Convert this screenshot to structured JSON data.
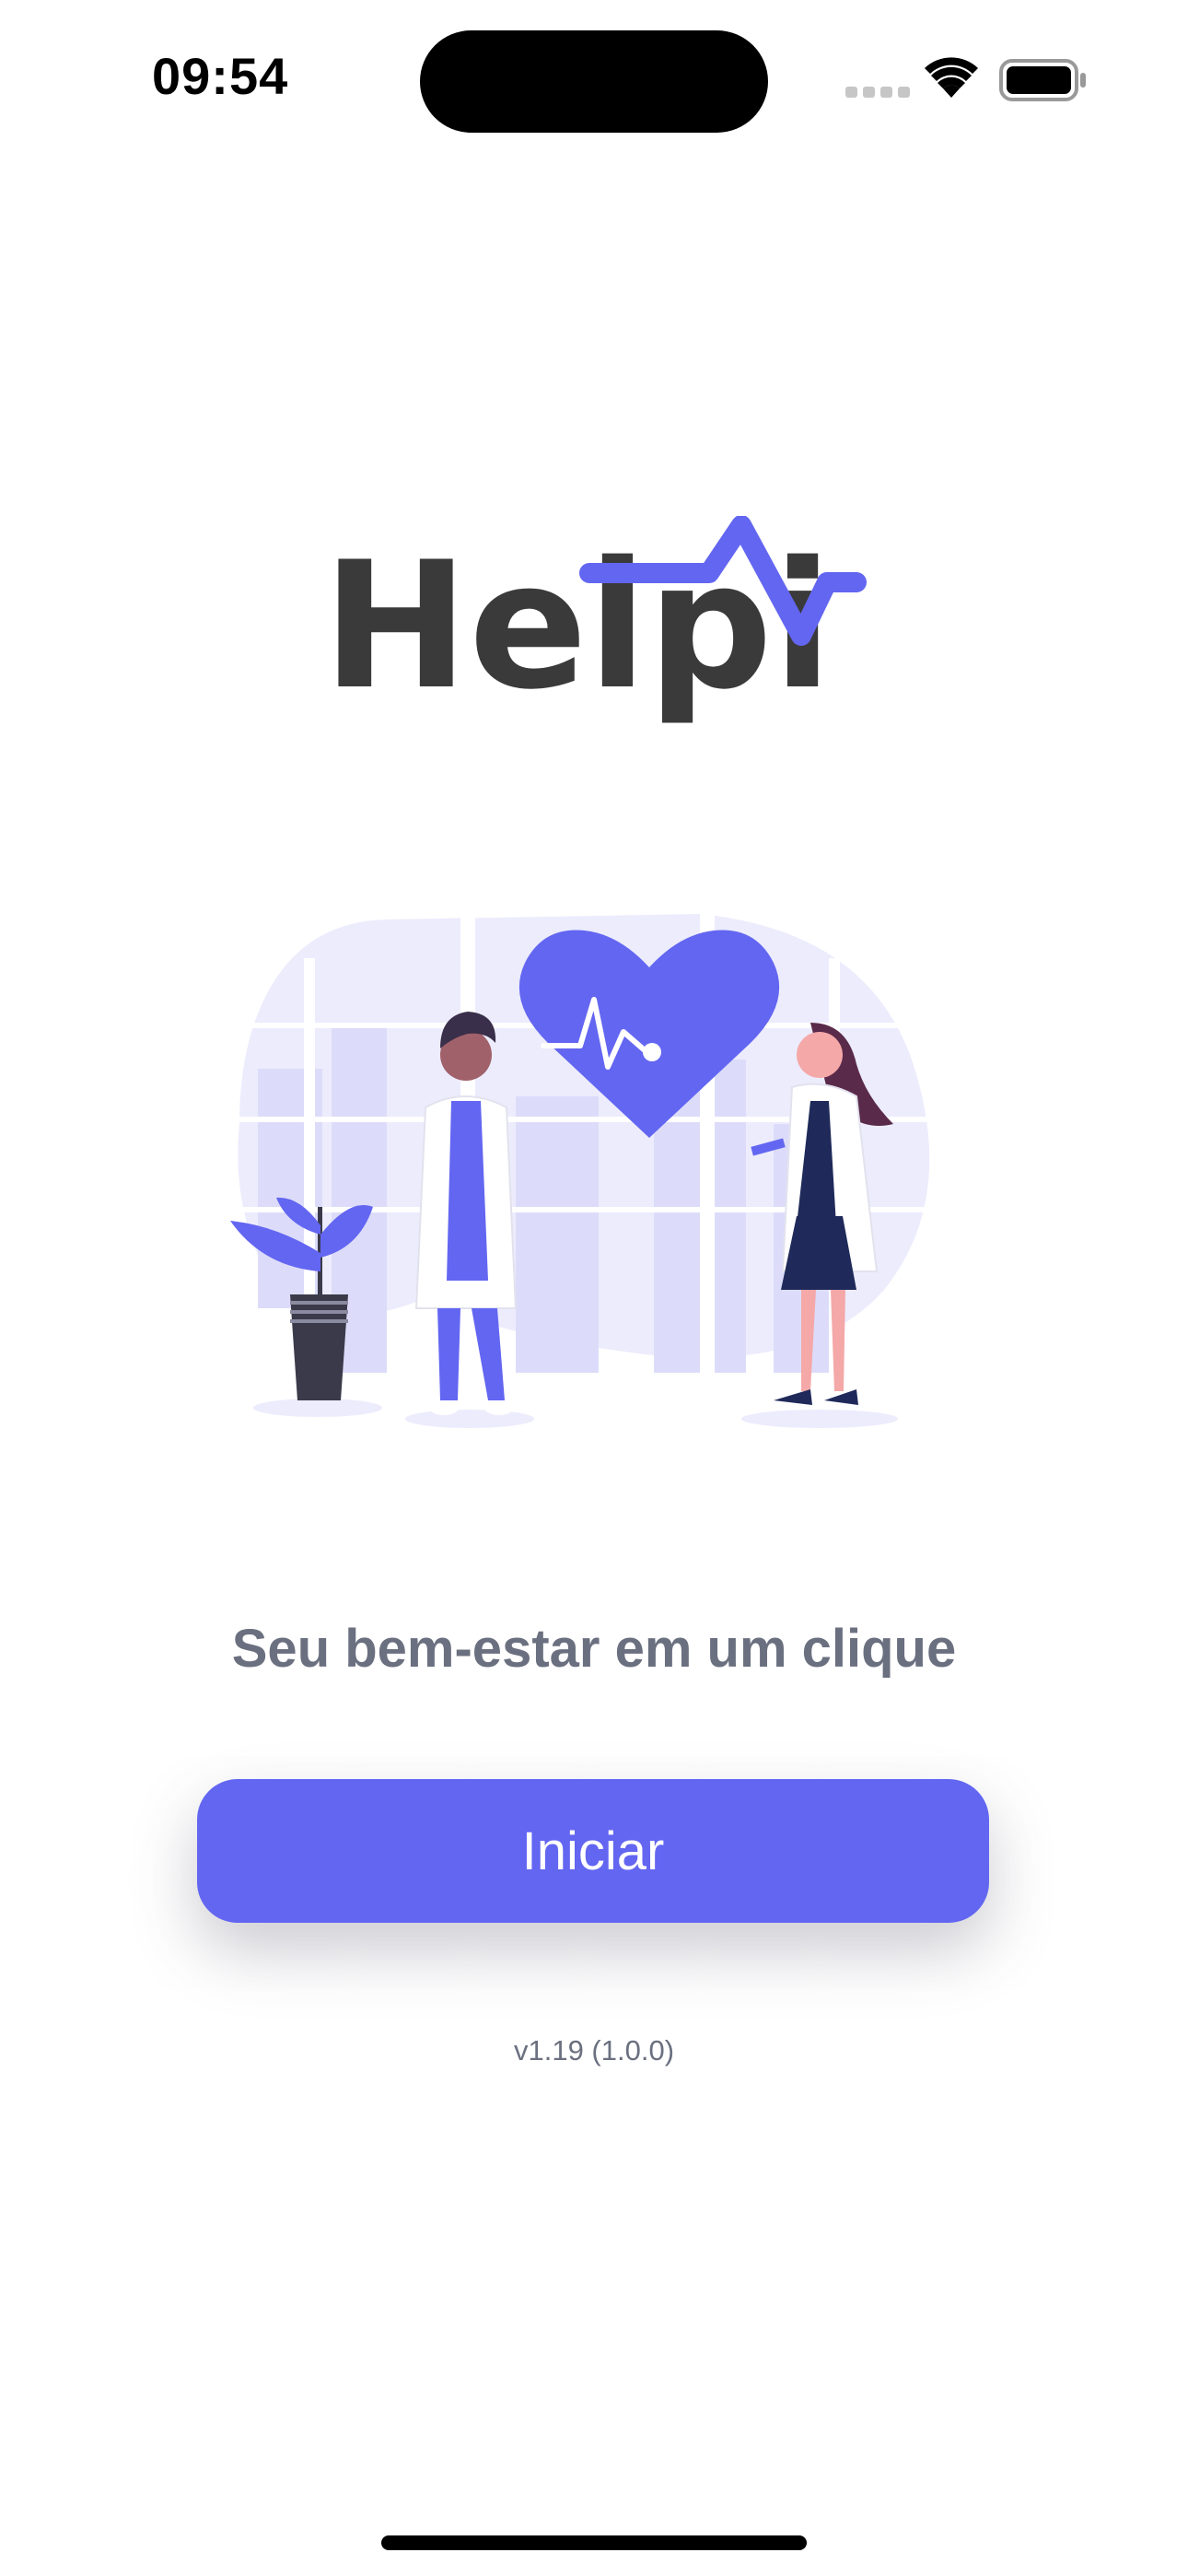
{
  "status_bar": {
    "time": "09:54",
    "icons": [
      "cellular-signal-icon",
      "wifi-icon",
      "battery-icon"
    ]
  },
  "brand": {
    "logo_text": "Helpi",
    "accent_color": "#6366f1",
    "text_color": "#3a3a3a"
  },
  "illustration": {
    "icon": "doctors-heart-illustration"
  },
  "welcome": {
    "tagline": "Seu bem-estar em um clique",
    "start_label": "Iniciar",
    "version": "v1.19 (1.0.0)"
  }
}
